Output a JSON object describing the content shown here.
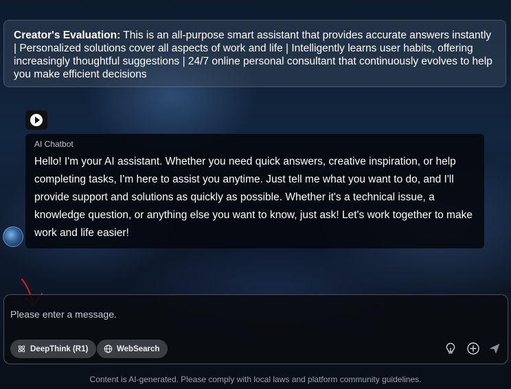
{
  "evaluation": {
    "label": "Creator's Evaluation:",
    "text": " This is an all-purpose smart assistant that provides accurate answers instantly | Personalized solutions cover all aspects of work and life | Intelligently learns user habits, offering increasingly thoughtful suggestions | 24/7 online personal consultant that continuously evolves to help you make efficient decisions"
  },
  "chat": {
    "bot_name": "AI Chatbot",
    "bot_message": "Hello! I'm your AI assistant. Whether you need quick answers, creative inspiration, or help completing tasks, I'm here to assist you anytime. Just tell me what you want to do, and I'll provide support and solutions as quickly as possible. Whether it's a technical issue, a knowledge question, or anything else you want to know, just ask! Let's work together to make work and life easier!"
  },
  "composer": {
    "placeholder": "Please enter a message.",
    "deepthink_label": "DeepThink (R1)",
    "websearch_label": "WebSearch"
  },
  "icons": {
    "play": "play-icon",
    "deepthink": "atom-icon",
    "websearch": "globe-icon",
    "bulb": "lightbulb-icon",
    "plus": "plus-circle-icon",
    "send": "send-icon"
  },
  "colors": {
    "annotation_arrow": "#e01b1b"
  },
  "footer": {
    "disclaimer": "Content is AI-generated. Please comply with local laws and platform community guidelines."
  }
}
